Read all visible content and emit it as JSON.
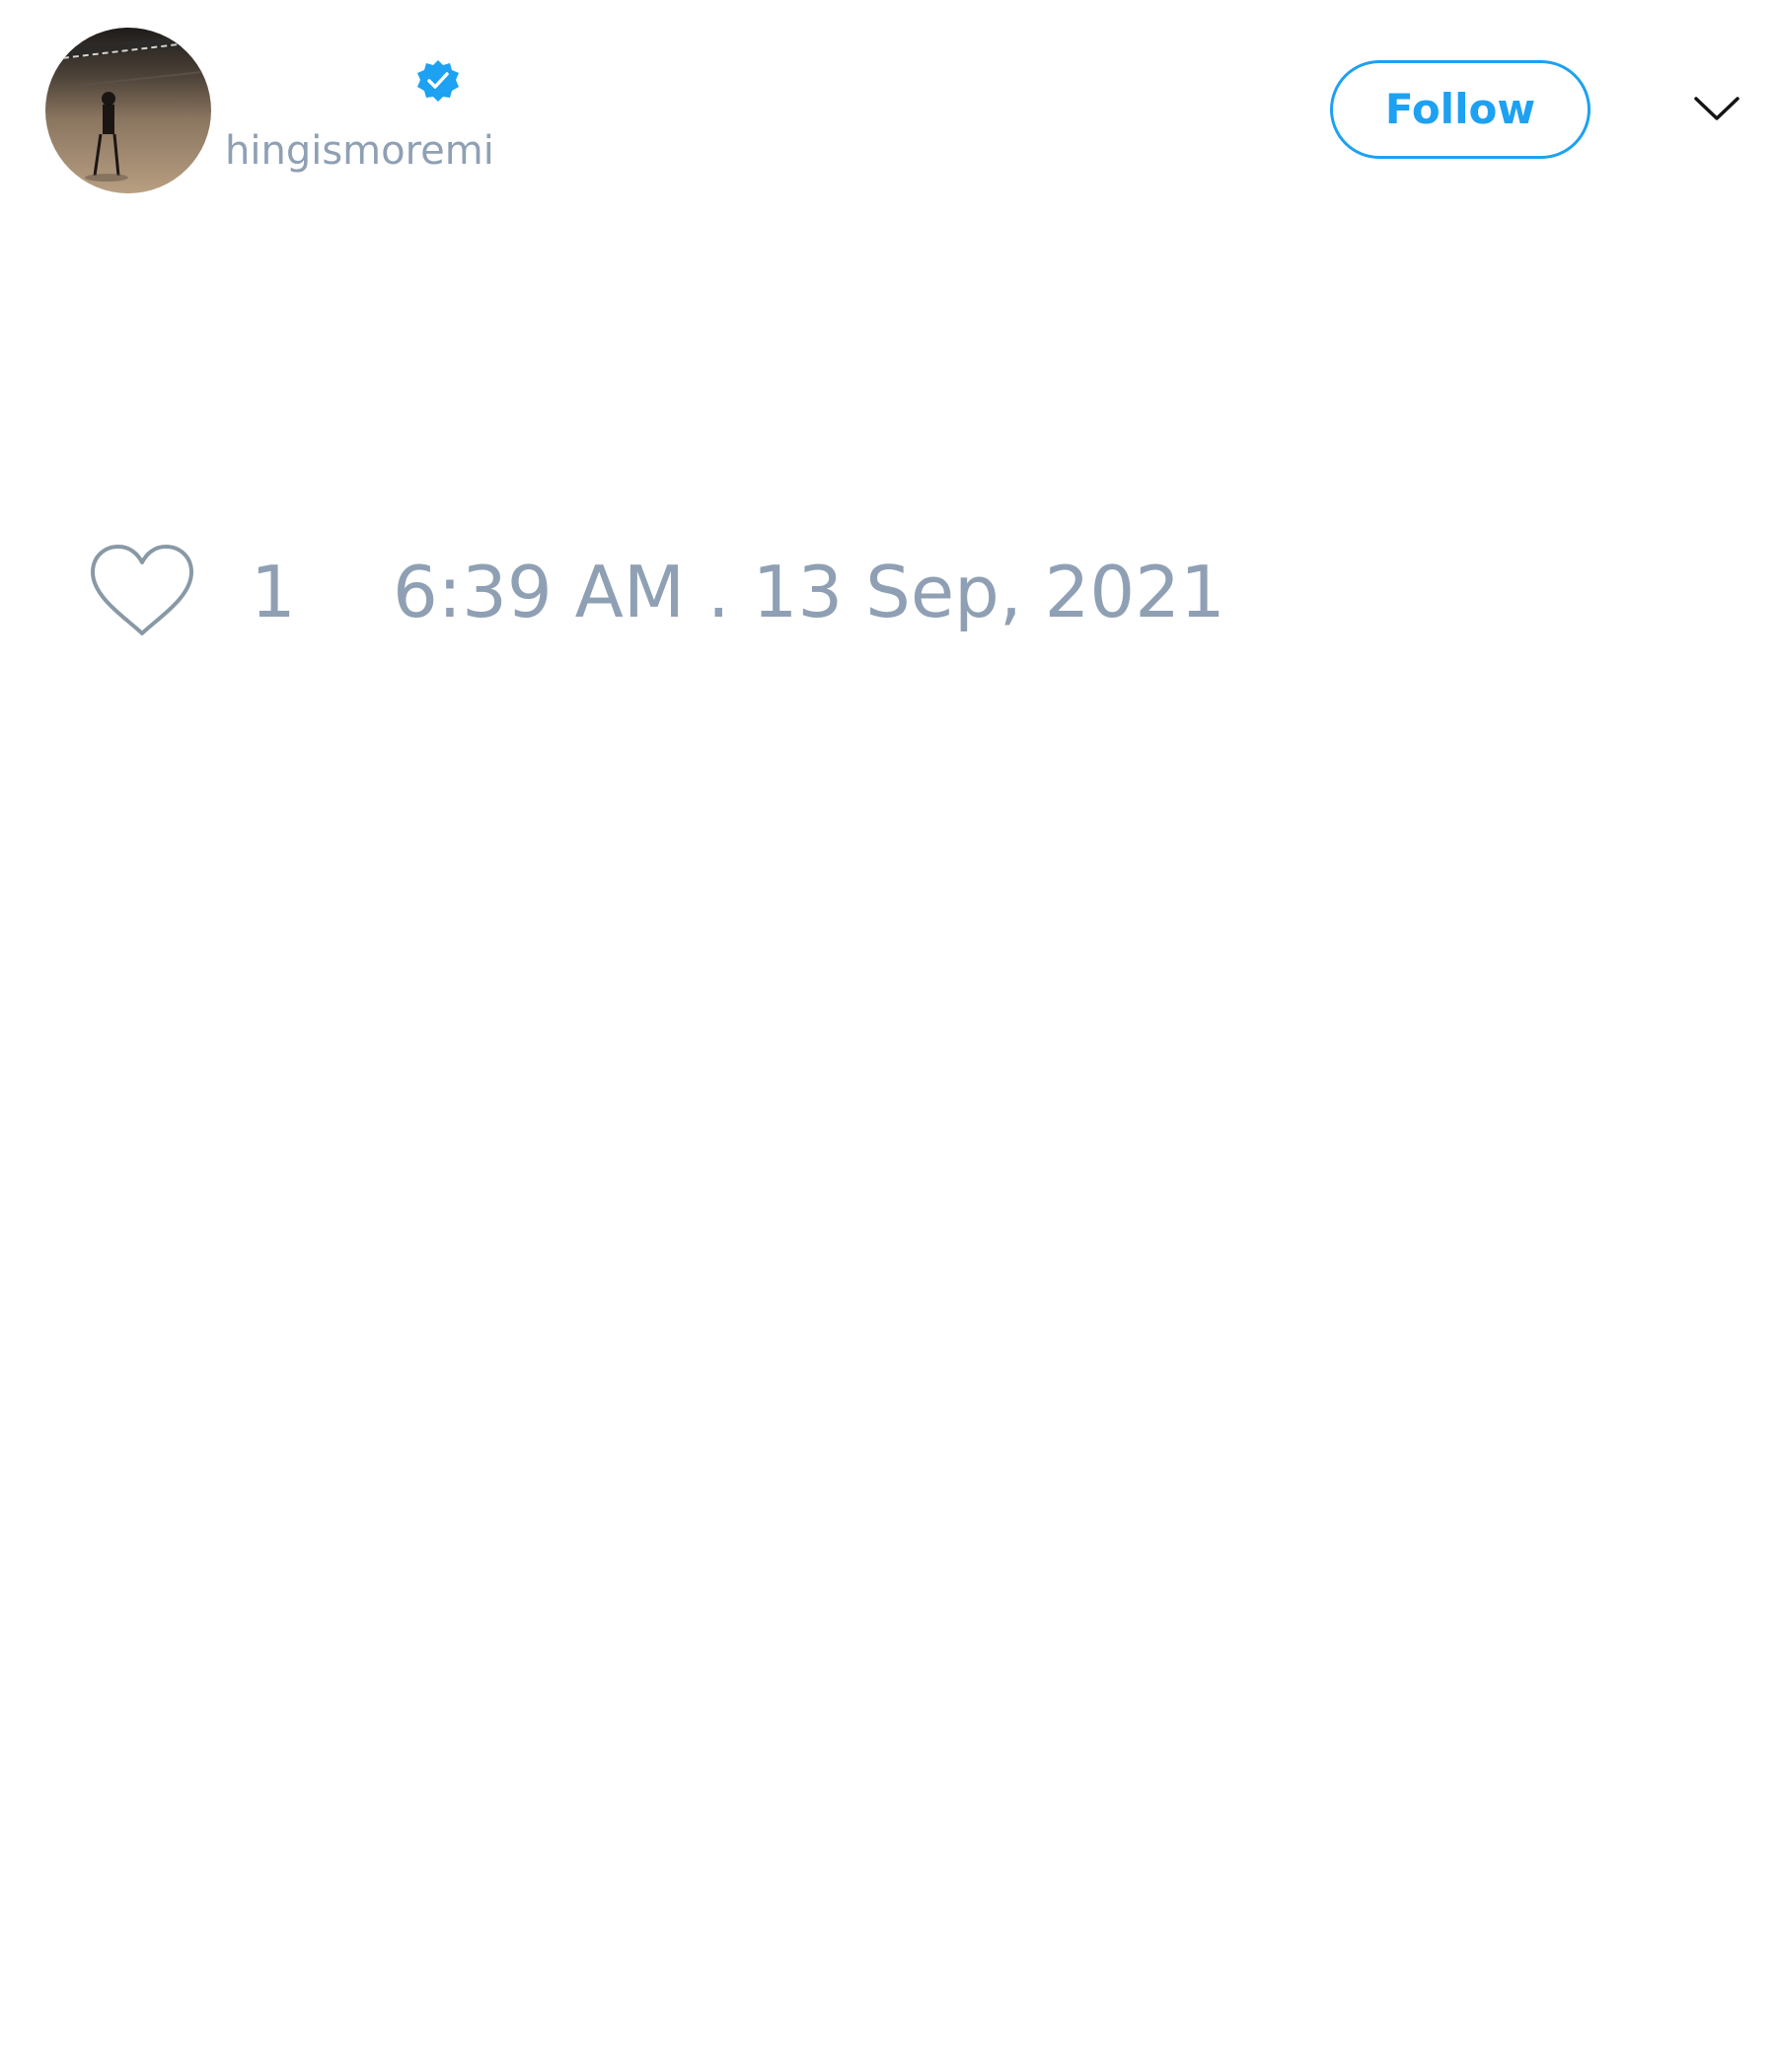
{
  "tweet": {
    "author": {
      "display_name": "",
      "handle": "hingismoremi",
      "verified": true,
      "avatar_icon": "profile-photo"
    },
    "follow_label": "Follow",
    "menu_icon": "chevron-down-icon",
    "likes": {
      "icon": "heart-outline-icon",
      "count": "1"
    },
    "timestamp": "6:39 AM . 13 Sep, 2021"
  },
  "colors": {
    "accent": "#1da1f2",
    "muted": "#8fa0b4",
    "heart": "#8899a6",
    "chevron": "#141414",
    "background": "#ffffff"
  }
}
